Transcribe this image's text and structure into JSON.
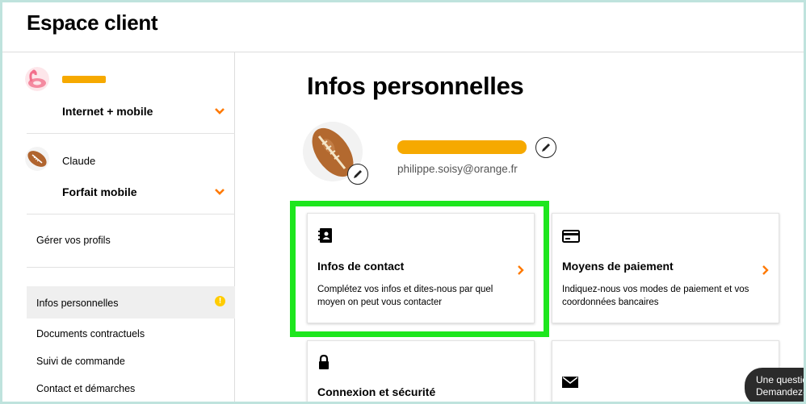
{
  "header": {
    "title": "Espace client"
  },
  "sidebar": {
    "profiles": [
      {
        "name": "",
        "offer": "Internet + mobile",
        "avatar": "flamingo-float-avatar"
      },
      {
        "name": "Claude",
        "offer": "Forfait mobile",
        "avatar": "football-avatar"
      }
    ],
    "manage_profiles": "Gérer vos profils",
    "menu": [
      {
        "label": "Infos personnelles",
        "active": true,
        "alert": "!"
      },
      {
        "label": "Documents contractuels"
      },
      {
        "label": "Suivi de commande"
      },
      {
        "label": "Contact et démarches"
      }
    ]
  },
  "main": {
    "title": "Infos personnelles",
    "user": {
      "name": "",
      "email": "philippe.soisy@orange.fr"
    },
    "cards": [
      {
        "title": "Infos de contact",
        "desc_line1": "Complétez vos infos et dites-nous par quel",
        "desc_line2": "moyen on peut vous contacter",
        "icon": "contact-book-icon",
        "highlighted": true
      },
      {
        "title": "Moyens de paiement",
        "desc_line1": "Indiquez-nous vos modes de paiement et vos",
        "desc_line2": "coordonnées bancaires",
        "icon": "credit-card-icon"
      },
      {
        "title": "Connexion et sécurité",
        "icon": "lock-icon"
      },
      {
        "title": "",
        "icon": "envelope-icon"
      }
    ]
  },
  "chat": {
    "line1": "Une questio",
    "line2": "Demandez-"
  },
  "colors": {
    "accent": "#ff7900",
    "redaction": "#f6a900",
    "highlight": "#1de61d",
    "alert": "#ffcc00"
  }
}
